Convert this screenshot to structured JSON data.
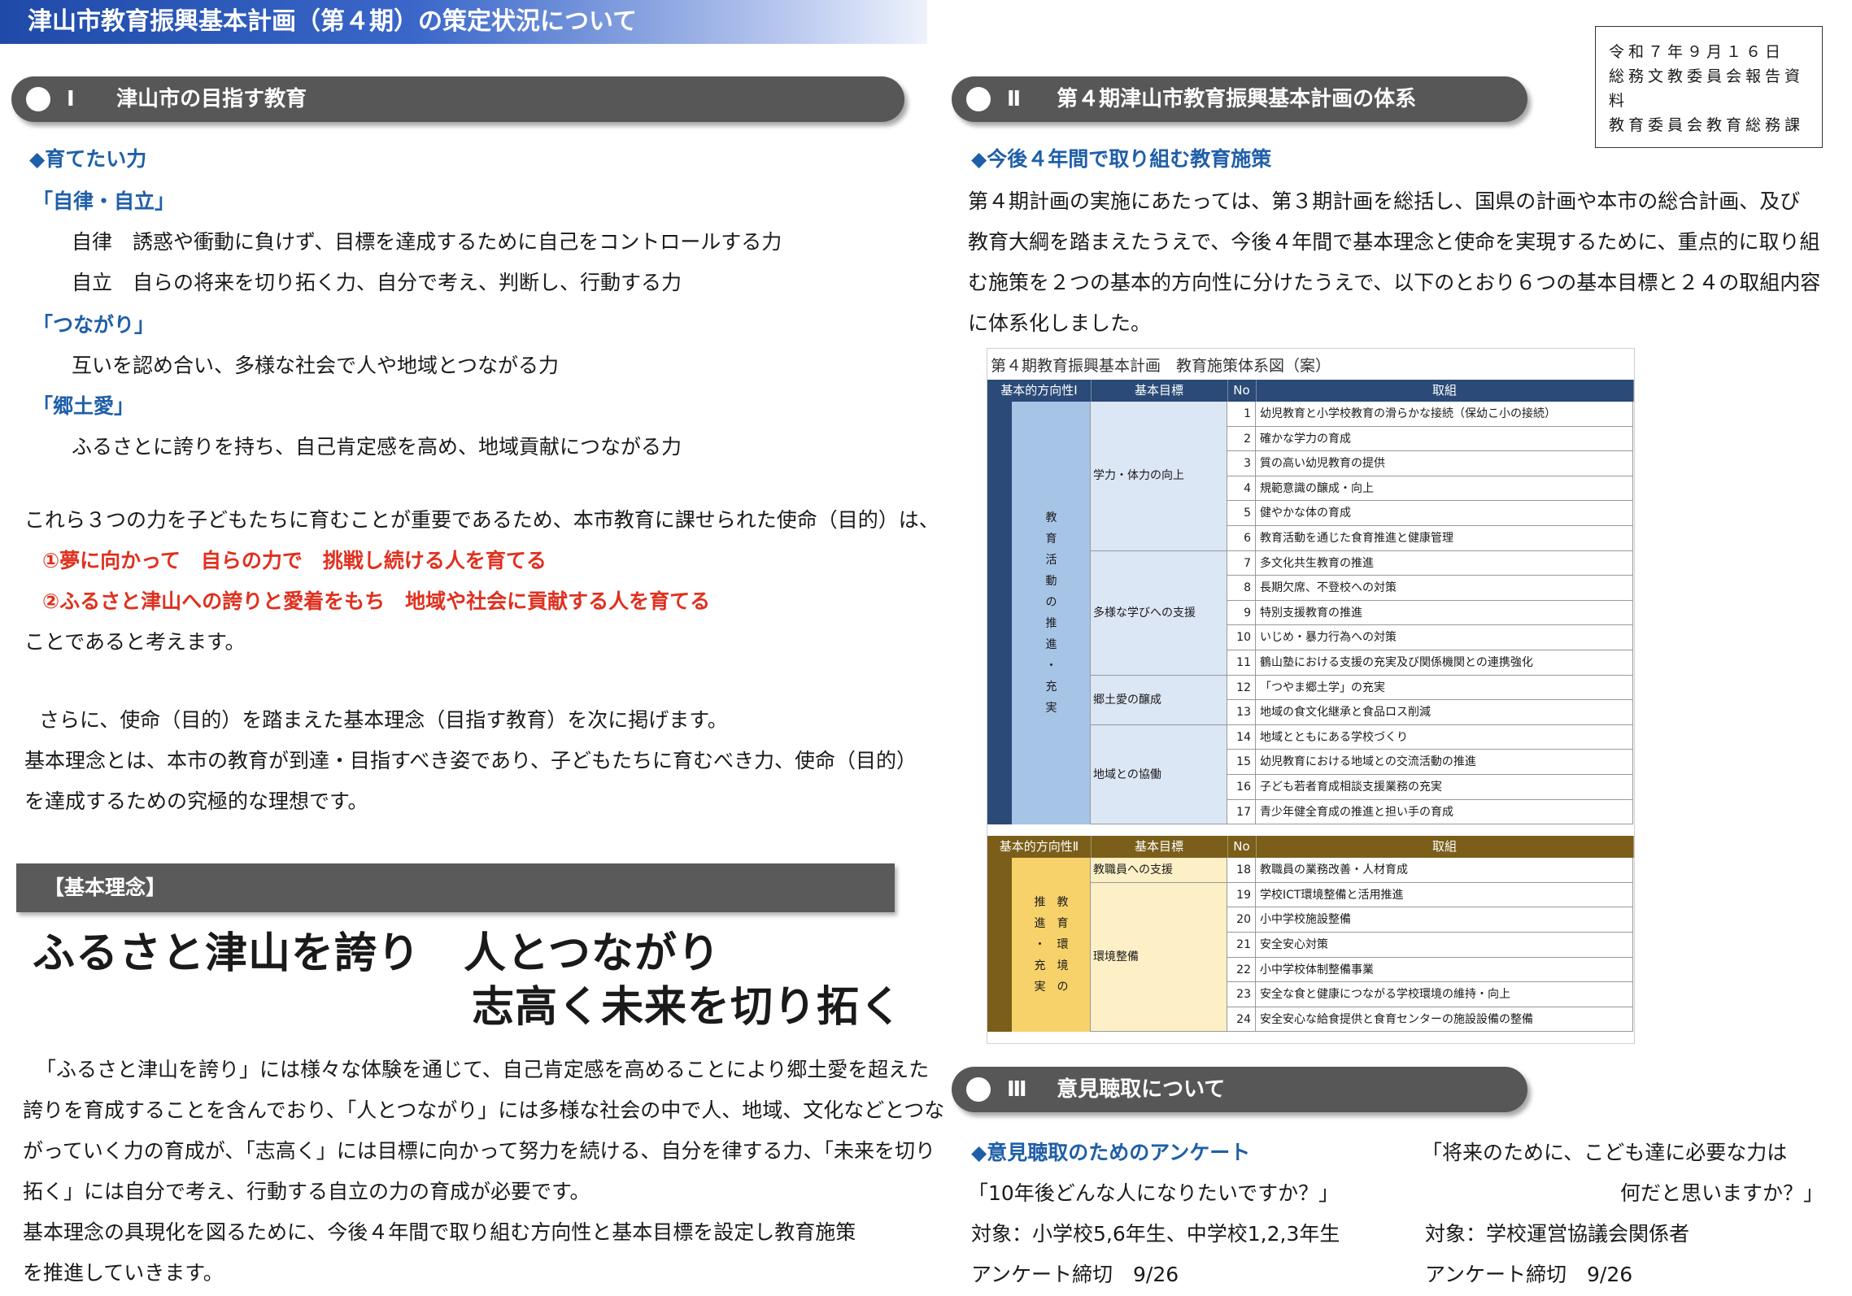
{
  "banner": "津山市教育振興基本計画（第４期）の策定状況について",
  "notice": [
    "令和７年９月１６日",
    "総務文教委員会報告資料",
    "教育委員会教育総務課"
  ],
  "section1": {
    "num": "Ⅰ",
    "title": "津山市の目指す教育",
    "subhead": "◆育てたい力",
    "groups": [
      {
        "heading": "「自律・自立」",
        "lines": [
          "自律　誘惑や衝動に負けず、目標を達成するために自己をコントロールする力",
          "自立　自らの将来を切り拓く力、自分で考え、判断し、行動する力"
        ]
      },
      {
        "heading": "「つながり」",
        "lines": [
          "互いを認め合い、多様な社会で人や地域とつながる力"
        ]
      },
      {
        "heading": "「郷土愛」",
        "lines": [
          "ふるさとに誇りを持ち、自己肯定感を高め、地域貢献につながる力"
        ]
      }
    ],
    "mission_intro": "これら３つの力を子どもたちに育むことが重要であるため、本市教育に課せられた使命（目的）は、",
    "mission1": "①夢に向かって　自らの力で　挑戦し続ける人を育てる",
    "mission2": "②ふるさと津山への誇りと愛着をもち　地域や社会に貢献する人を育てる",
    "mission_end": "ことであると考えます。",
    "para2": [
      "さらに、使命（目的）を踏まえた基本理念（目指す教育）を次に掲げます。",
      "基本理念とは、本市の教育が到達・目指すべき姿であり、子どもたちに育むべき力、使命（目的）",
      "を達成するための究極的な理想です。"
    ],
    "kihon_label": "【基本理念】",
    "slogan1": "ふるさと津山を誇り　人とつながり",
    "slogan2": "志高く未来を切り拓く",
    "para3": [
      "「ふるさと津山を誇り」には様々な体験を通じて、自己肯定感を高めることにより郷土愛を超えた",
      "誇りを育成することを含んでおり、「人とつながり」には多様な社会の中で人、地域、文化などとつな",
      "がっていく力の育成が、「志高く」には目標に向かって努力を続ける、自分を律する力、「未来を切り",
      "拓く」には自分で考え、行動する自立の力の育成が必要です。",
      "基本理念の具現化を図るために、今後４年間で取り組む方向性と基本目標を設定し教育施策",
      "を推進していきます。"
    ]
  },
  "section2": {
    "num": "Ⅱ",
    "title": "第４期津山市教育振興基本計画の体系",
    "subhead": "◆今後４年間で取り組む教育施策",
    "para": [
      "第４期計画の実施にあたっては、第３期計画を総括し、国県の計画や本市の総合計画、及び",
      "教育大綱を踏まえたうえで、今後４年間で基本理念と使命を実現するために、重点的に取り組",
      "む施策を２つの基本的方向性に分けたうえで、以下のとおり６つの基本目標と２４の取組内容",
      "に体系化しました。"
    ],
    "table": {
      "title": "第４期教育振興基本計画　教育施策体系図（案）",
      "colors": {
        "block1_header": "#2b4a77",
        "block1_side": "#a6c4e6",
        "block1_goal": "#dbe7f5",
        "block2_header": "#7a5e1a",
        "block2_side": "#f7d26a",
        "block2_goal": "#fdf0c6"
      },
      "block1": {
        "headers": [
          "基本的方向性Ⅰ",
          "基本目標",
          "No",
          "取組"
        ],
        "direction": "教育活動の推進・充実",
        "goals": [
          {
            "name": "学力・体力の向上",
            "items": [
              {
                "no": "1",
                "text": "幼児教育と小学校教育の滑らかな接続（保幼こ小の接続）"
              },
              {
                "no": "2",
                "text": "確かな学力の育成"
              },
              {
                "no": "3",
                "text": "質の高い幼児教育の提供"
              },
              {
                "no": "4",
                "text": "規範意識の醸成・向上"
              },
              {
                "no": "5",
                "text": "健やかな体の育成"
              },
              {
                "no": "6",
                "text": "教育活動を通じた食育推進と健康管理"
              }
            ]
          },
          {
            "name": "多様な学びへの支援",
            "items": [
              {
                "no": "7",
                "text": "多文化共生教育の推進"
              },
              {
                "no": "8",
                "text": "長期欠席、不登校への対策"
              },
              {
                "no": "9",
                "text": "特別支援教育の推進"
              },
              {
                "no": "10",
                "text": "いじめ・暴力行為への対策"
              },
              {
                "no": "11",
                "text": "鶴山塾における支援の充実及び関係機関との連携強化"
              }
            ]
          },
          {
            "name": "郷土愛の醸成",
            "items": [
              {
                "no": "12",
                "text": "「つやま郷土学」の充実"
              },
              {
                "no": "13",
                "text": "地域の食文化継承と食品ロス削減"
              }
            ]
          },
          {
            "name": "地域との協働",
            "items": [
              {
                "no": "14",
                "text": "地域とともにある学校づくり"
              },
              {
                "no": "15",
                "text": "幼児教育における地域との交流活動の推進"
              },
              {
                "no": "16",
                "text": "子ども若者育成相談支援業務の充実"
              },
              {
                "no": "17",
                "text": "青少年健全育成の推進と担い手の育成"
              }
            ]
          }
        ]
      },
      "block2": {
        "headers": [
          "基本的方向性Ⅱ",
          "基本目標",
          "No",
          "取組"
        ],
        "direction": "教育環境の推進・充実",
        "goals": [
          {
            "name": "教職員への支援",
            "items": [
              {
                "no": "18",
                "text": "教職員の業務改善・人材育成"
              }
            ]
          },
          {
            "name": "環境整備",
            "items": [
              {
                "no": "19",
                "text": "学校ICT環境整備と活用推進"
              },
              {
                "no": "20",
                "text": "小中学校施設整備"
              },
              {
                "no": "21",
                "text": "安全安心対策"
              },
              {
                "no": "22",
                "text": "小中学校体制整備事業"
              },
              {
                "no": "23",
                "text": "安全な食と健康につながる学校環境の維持・向上"
              },
              {
                "no": "24",
                "text": "安全安心な給食提供と食育センターの施設設備の整備"
              }
            ]
          }
        ]
      }
    }
  },
  "section3": {
    "num": "Ⅲ",
    "title": "意見聴取について",
    "subhead": "◆意見聴取のためのアンケート",
    "left": [
      "「10年後どんな人になりたいですか？」",
      "対象：小学校5,6年生、中学校1,2,3年生",
      "アンケート締切　9/26"
    ],
    "right_q1": "「将来のために、こども達に必要な力は",
    "right_q2": "何だと思いますか？」",
    "right": [
      "対象：学校運営協議会関係者",
      "アンケート締切　9/26"
    ]
  }
}
